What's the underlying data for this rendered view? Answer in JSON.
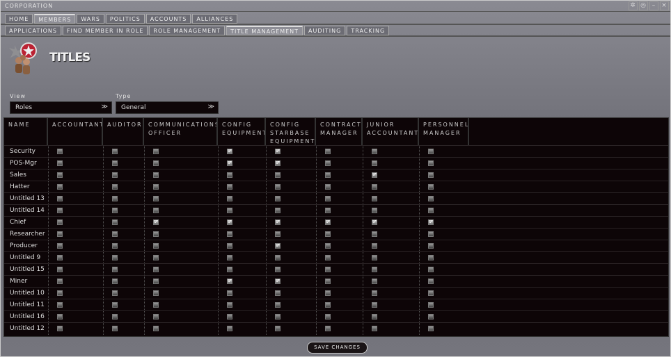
{
  "window": {
    "title": "CORPORATION",
    "controls": [
      "pin",
      "settings",
      "minimize",
      "close"
    ]
  },
  "main_tabs": [
    {
      "label": "HOME"
    },
    {
      "label": "MEMBERS",
      "active": true
    },
    {
      "label": "WARS"
    },
    {
      "label": "POLITICS"
    },
    {
      "label": "ACCOUNTS"
    },
    {
      "label": "ALLIANCES"
    }
  ],
  "sub_tabs": [
    {
      "label": "APPLICATIONS"
    },
    {
      "label": "FIND MEMBER IN ROLE"
    },
    {
      "label": "ROLE MANAGEMENT"
    },
    {
      "label": "TITLE MANAGEMENT",
      "active": true
    },
    {
      "label": "AUDITING"
    },
    {
      "label": "TRACKING"
    }
  ],
  "page_title": "TITLES",
  "filters": {
    "view_label": "View",
    "view_value": "Roles",
    "type_label": "Type",
    "type_value": "General"
  },
  "columns": [
    "NAME",
    "ACCOUNTANT",
    "AUDITOR",
    "COMMUNICATIONS OFFICER",
    "CONFIG EQUIPMENT",
    "CONFIG STARBASE EQUIPMENT",
    "CONTRACT MANAGER",
    "JUNIOR ACCOUNTANT",
    "PERSONNEL MANAGER"
  ],
  "rows": [
    {
      "name": "Security",
      "roles": [
        0,
        0,
        0,
        1,
        1,
        0,
        0,
        0
      ]
    },
    {
      "name": "POS-Mgr",
      "roles": [
        0,
        0,
        0,
        1,
        1,
        0,
        0,
        0
      ]
    },
    {
      "name": "Sales",
      "roles": [
        0,
        0,
        0,
        0,
        0,
        0,
        1,
        0
      ]
    },
    {
      "name": "Hatter",
      "roles": [
        0,
        0,
        0,
        0,
        0,
        0,
        0,
        0
      ]
    },
    {
      "name": "Untitled 13",
      "roles": [
        0,
        0,
        0,
        0,
        0,
        0,
        0,
        0
      ]
    },
    {
      "name": "Untitled 14",
      "roles": [
        0,
        0,
        0,
        0,
        0,
        0,
        0,
        0
      ]
    },
    {
      "name": "Chief",
      "roles": [
        0,
        0,
        1,
        1,
        1,
        1,
        1,
        1
      ]
    },
    {
      "name": "Researcher",
      "roles": [
        0,
        0,
        0,
        0,
        0,
        0,
        0,
        0
      ]
    },
    {
      "name": "Producer",
      "roles": [
        0,
        0,
        0,
        0,
        1,
        0,
        0,
        0
      ]
    },
    {
      "name": "Untitled 9",
      "roles": [
        0,
        0,
        0,
        0,
        0,
        0,
        0,
        0
      ]
    },
    {
      "name": "Untitled 15",
      "roles": [
        0,
        0,
        0,
        0,
        0,
        0,
        0,
        0
      ]
    },
    {
      "name": "Miner",
      "roles": [
        0,
        0,
        0,
        1,
        1,
        0,
        0,
        0
      ]
    },
    {
      "name": "Untitled 10",
      "roles": [
        0,
        0,
        0,
        0,
        0,
        0,
        0,
        0
      ]
    },
    {
      "name": "Untitled 11",
      "roles": [
        0,
        0,
        0,
        0,
        0,
        0,
        0,
        0
      ]
    },
    {
      "name": "Untitled 16",
      "roles": [
        0,
        0,
        0,
        0,
        0,
        0,
        0,
        0
      ]
    },
    {
      "name": "Untitled 12",
      "roles": [
        0,
        0,
        0,
        0,
        0,
        0,
        0,
        0
      ]
    }
  ],
  "save_label": "SAVE CHANGES"
}
